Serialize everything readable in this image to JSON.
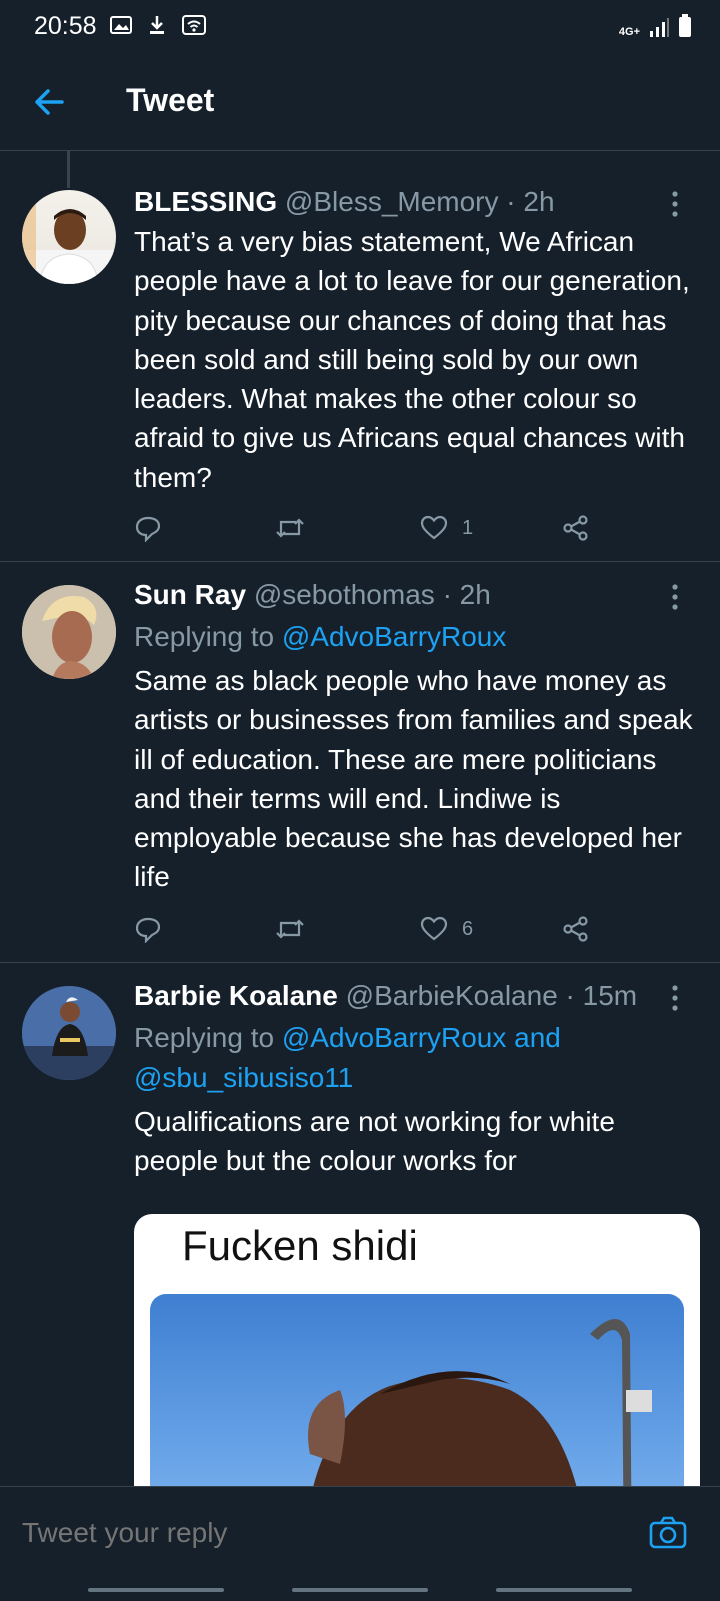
{
  "status_bar": {
    "time": "20:58",
    "network": "4G+"
  },
  "header": {
    "title": "Tweet"
  },
  "tweets": [
    {
      "name": "BLESSING",
      "handle": "@Bless_Memory",
      "time": "· 2h",
      "text": "That’s a very bias statement, We African people have a lot to leave for our generation, pity because our chances of doing that has been sold and still being sold by our own leaders. What makes the other colour so afraid to give us Africans equal chances with them?",
      "likes": "1"
    },
    {
      "name": "Sun Ray",
      "handle": "@sebothomas",
      "time": "· 2h",
      "replying_label": "Replying to",
      "replying_to": "@AdvoBarryRoux",
      "text": "Same as black people who have money as artists or businesses from families and speak ill of education. These are mere politicians and their terms will end. Lindiwe is employable because she has developed her life",
      "likes": "6"
    },
    {
      "name": "Barbie Koalane",
      "handle": "@BarbieKoalane",
      "time": "· 15m",
      "replying_label": "Replying to",
      "replying_to": "@AdvoBarryRoux and @sbu_sibusiso11",
      "text": "Qualifications are not working for white people but the colour works for",
      "media_caption": "Fucken shidi"
    }
  ],
  "reply": {
    "placeholder": "Tweet your reply"
  },
  "colors": {
    "background": "#15202b",
    "accent": "#1da1f2",
    "muted": "#8899a6",
    "divider": "#38444d"
  }
}
